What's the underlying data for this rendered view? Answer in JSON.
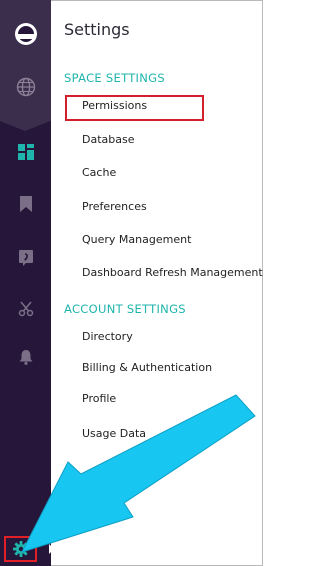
{
  "panel": {
    "title": "Settings"
  },
  "sections": {
    "space_title": "SPACE SETTINGS",
    "space_items": [
      "Permissions",
      "Database",
      "Cache",
      "Preferences",
      "Query Management",
      "Dashboard Refresh Management"
    ],
    "account_title": "ACCOUNT SETTINGS",
    "account_items": [
      "Directory",
      "Billing & Authentication",
      "Profile",
      "Usage Data"
    ]
  },
  "rail": {
    "icons": [
      "logo-icon",
      "globe-icon",
      "dashboard-icon",
      "bookmark-icon",
      "comment-icon",
      "scissors-icon",
      "bell-icon",
      "gear-icon"
    ]
  },
  "colors": {
    "rail_bg": "#26173a",
    "rail_top_bg": "#3b2e4d",
    "accent_teal": "#1fb5ac",
    "highlight_red": "#d4202a",
    "arrow_cyan": "#17c7f2"
  }
}
